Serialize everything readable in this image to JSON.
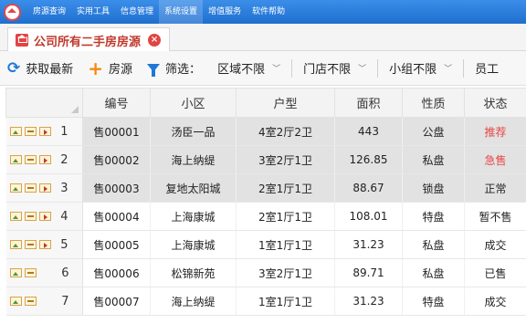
{
  "menubar": {
    "items": [
      {
        "label": "房源查询",
        "active": false
      },
      {
        "label": "实用工具",
        "active": false
      },
      {
        "label": "信息管理",
        "active": false
      },
      {
        "label": "系统设置",
        "active": true
      },
      {
        "label": "增值服务",
        "active": false
      },
      {
        "label": "软件帮助",
        "active": false
      }
    ]
  },
  "tab": {
    "label": "公司所有二手房房源",
    "close": "×"
  },
  "toolbar": {
    "refresh_label": "获取最新",
    "add_label": "房源",
    "filter_label": "筛选：",
    "dropdowns": [
      "区域不限",
      "门店不限",
      "小组不限",
      "员工"
    ]
  },
  "colors": {
    "accent": "#1e78d7",
    "menubar": "#2a7fe0",
    "status_red": "#e84545",
    "selected_row": "#e2e2e2"
  },
  "table": {
    "columns": [
      "编号",
      "小区",
      "户型",
      "面积",
      "性质",
      "状态"
    ],
    "rows": [
      {
        "num": "1",
        "id": "售00001",
        "community": "汤臣一品",
        "layout": "4室2厅2卫",
        "area": "443",
        "type": "公盘",
        "status": "推荐",
        "status_red": true,
        "selected": true,
        "icons": 3
      },
      {
        "num": "2",
        "id": "售00002",
        "community": "海上纳缇",
        "layout": "3室2厅1卫",
        "area": "126.85",
        "type": "私盘",
        "status": "急售",
        "status_red": true,
        "selected": true,
        "icons": 3
      },
      {
        "num": "3",
        "id": "售00003",
        "community": "复地太阳城",
        "layout": "2室1厅1卫",
        "area": "88.67",
        "type": "锁盘",
        "status": "正常",
        "status_red": false,
        "selected": true,
        "icons": 3
      },
      {
        "num": "4",
        "id": "售00004",
        "community": "上海康城",
        "layout": "2室1厅1卫",
        "area": "108.01",
        "type": "特盘",
        "status": "暂不售",
        "status_red": false,
        "selected": false,
        "icons": 3
      },
      {
        "num": "5",
        "id": "售00005",
        "community": "上海康城",
        "layout": "1室1厅1卫",
        "area": "31.23",
        "type": "私盘",
        "status": "成交",
        "status_red": false,
        "selected": false,
        "icons": 3
      },
      {
        "num": "6",
        "id": "售00006",
        "community": "松锦新苑",
        "layout": "3室2厅1卫",
        "area": "89.71",
        "type": "私盘",
        "status": "已售",
        "status_red": false,
        "selected": false,
        "icons": 2
      },
      {
        "num": "7",
        "id": "售00007",
        "community": "海上纳缇",
        "layout": "1室1厅1卫",
        "area": "31.23",
        "type": "特盘",
        "status": "成交",
        "status_red": false,
        "selected": false,
        "icons": 2
      }
    ]
  }
}
